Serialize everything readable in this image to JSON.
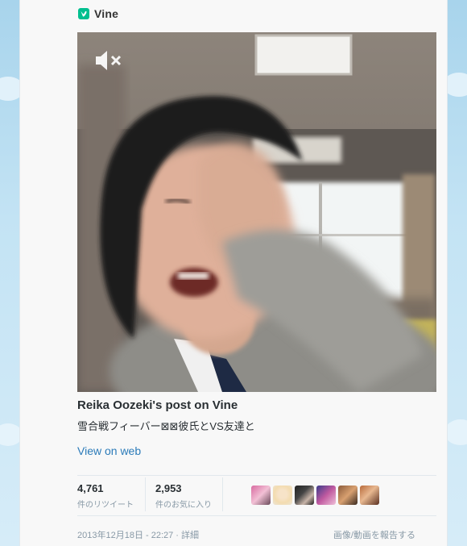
{
  "header": {
    "app_name": "Vine",
    "logo_icon": "vine-logo-icon",
    "logo_color": "#00bf8f"
  },
  "video": {
    "mute_icon": "muted-speaker-icon"
  },
  "post": {
    "title": "Reika Oozeki's post on Vine",
    "description": "雪合戦フィーバー⊠⊠彼氏とVS友達と",
    "view_link": "View on web",
    "link_color": "#2b7bb9"
  },
  "stats": {
    "retweets": {
      "count": "4,761",
      "label": "件のリツイート"
    },
    "favorites": {
      "count": "2,953",
      "label": "件のお気に入り"
    }
  },
  "avatars": [
    "avatar-1",
    "avatar-2",
    "avatar-3",
    "avatar-4",
    "avatar-5",
    "avatar-6"
  ],
  "footer": {
    "date_text": "2013年12月18日 - 22:27 · 詳細",
    "report_text": "画像/動画を報告する"
  }
}
